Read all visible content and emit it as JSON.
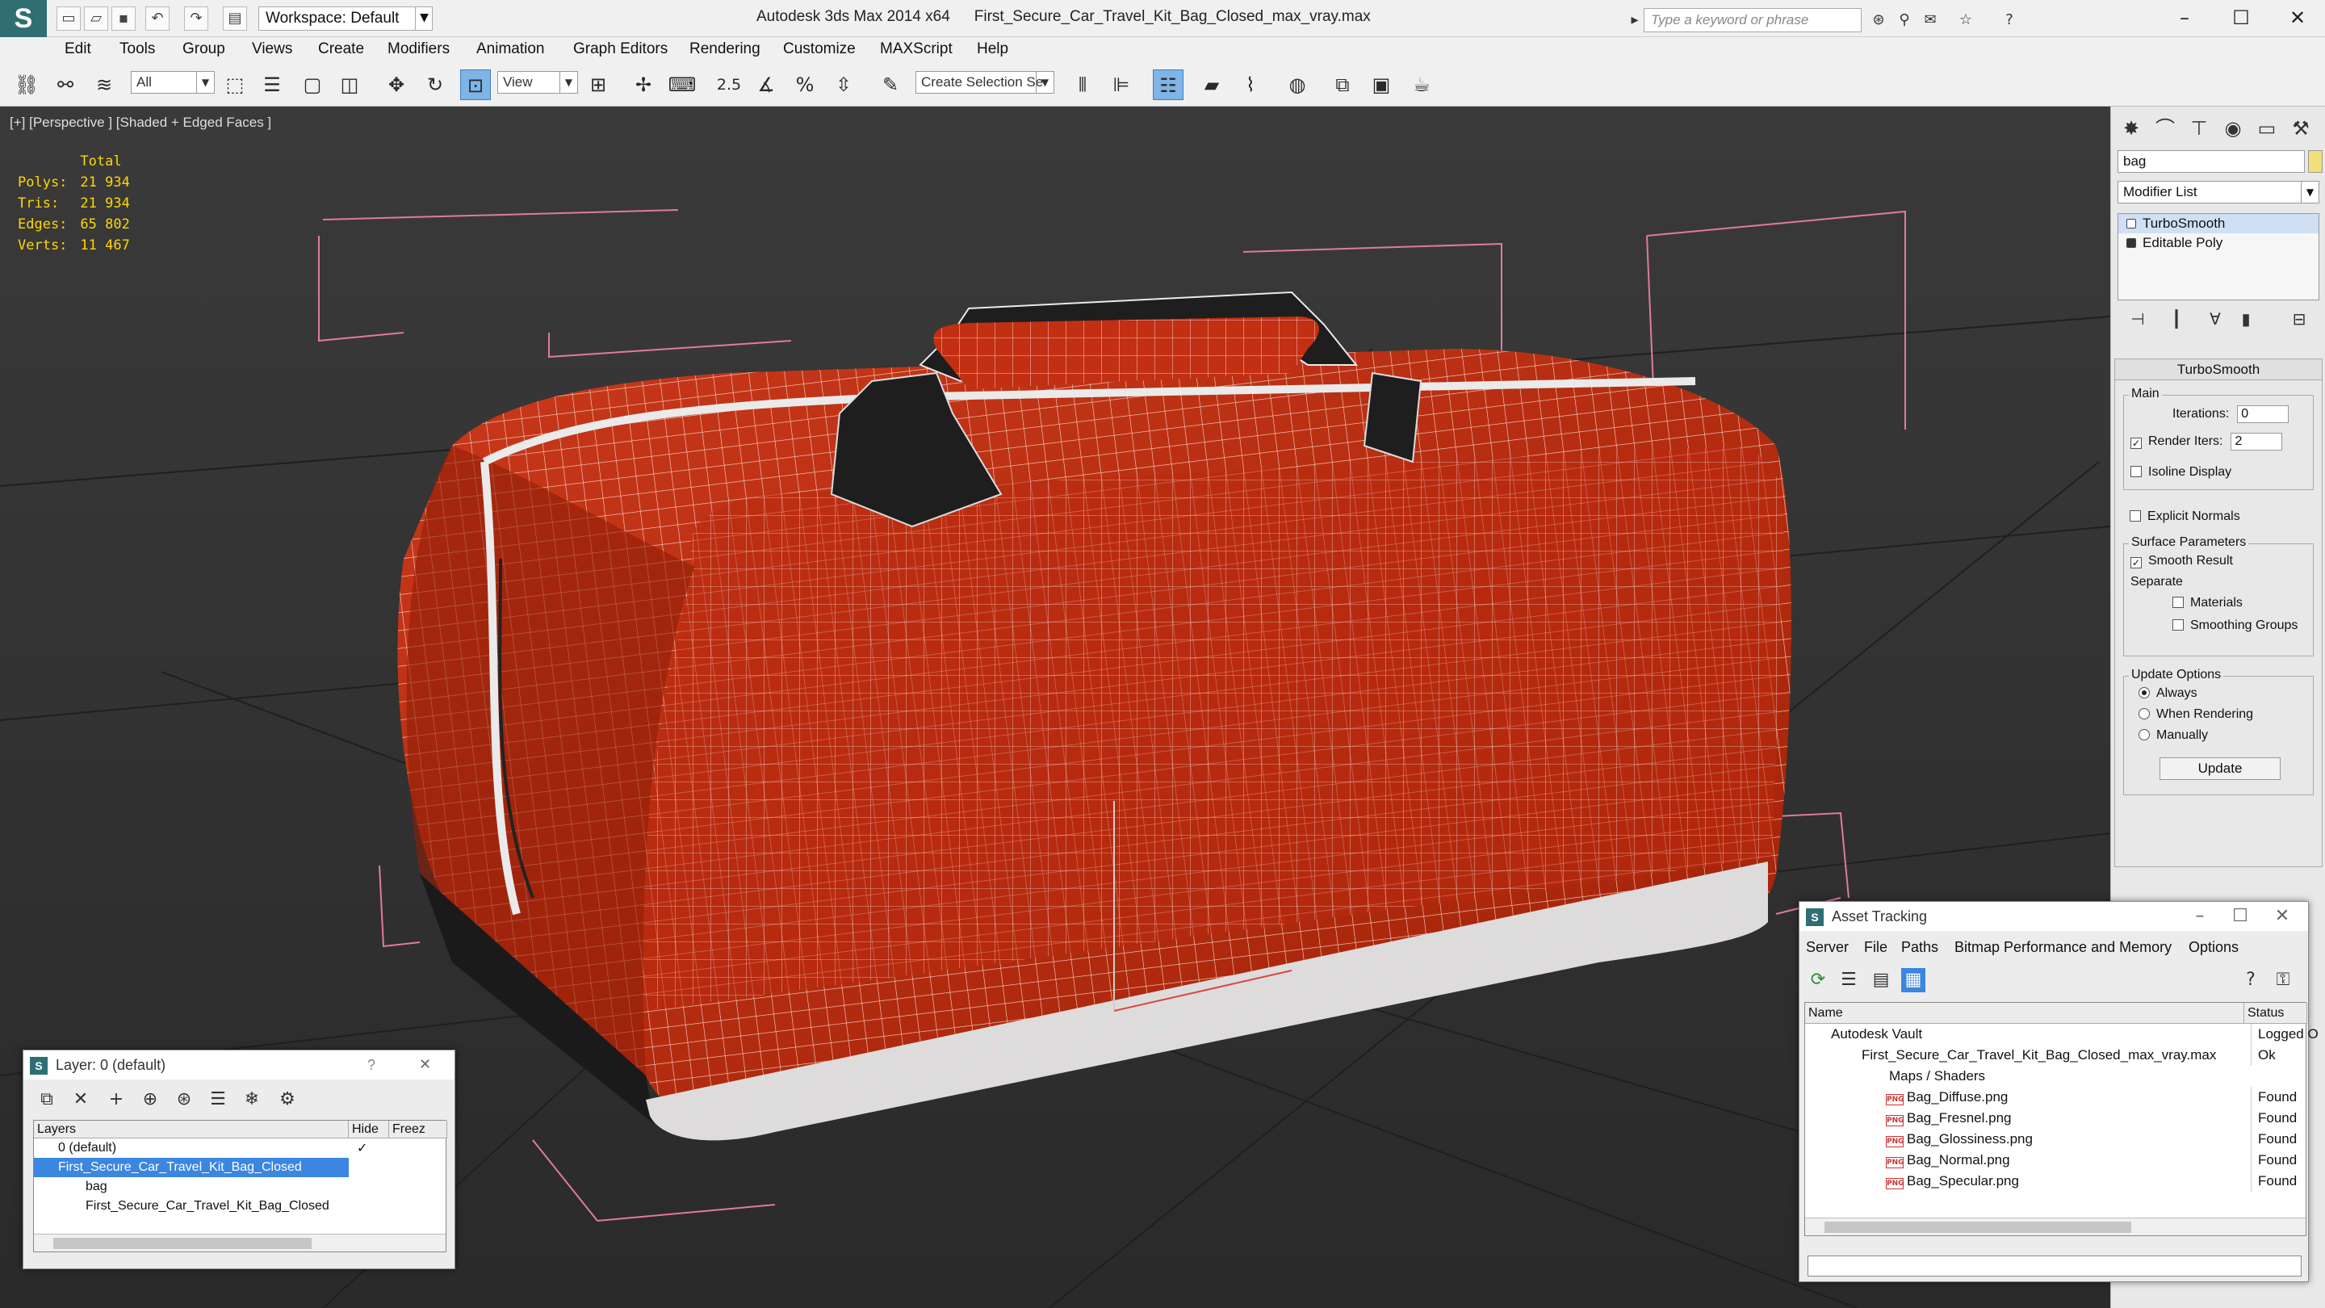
{
  "titlebar": {
    "workspace": "Workspace: Default",
    "app": "Autodesk 3ds Max  2014 x64",
    "file": "First_Secure_Car_Travel_Kit_Bag_Closed_max_vray.max",
    "search_placeholder": "Type a keyword or phrase"
  },
  "menubar": [
    "Edit",
    "Tools",
    "Group",
    "Views",
    "Create",
    "Modifiers",
    "Animation",
    "Graph Editors",
    "Rendering",
    "Customize",
    "MAXScript",
    "Help"
  ],
  "toolbar": {
    "filter": "All",
    "view": "View",
    "snap_angle": "2.5",
    "selection_set": "Create Selection Se"
  },
  "viewport": {
    "label": "[+] [Perspective ] [Shaded + Edged Faces ]",
    "stats_header": "Total",
    "stats": [
      {
        "label": "Polys:",
        "value": "21 934"
      },
      {
        "label": "Tris:",
        "value": "21 934"
      },
      {
        "label": "Edges:",
        "value": "65 802"
      },
      {
        "label": "Verts:",
        "value": "11 467"
      }
    ]
  },
  "command_panel": {
    "object_name": "bag",
    "modifier_list": "Modifier List",
    "stack": [
      "TurboSmooth",
      "Editable Poly"
    ],
    "turbosmooth": {
      "title": "TurboSmooth",
      "main_label": "Main",
      "iterations_label": "Iterations:",
      "iterations": "0",
      "render_iters_label": "Render Iters:",
      "render_iters": "2",
      "isoline": "Isoline Display",
      "explicit_normals": "Explicit Normals",
      "surface_params": "Surface Parameters",
      "smooth_result": "Smooth Result",
      "separate": "Separate",
      "materials": "Materials",
      "smoothing_groups": "Smoothing Groups",
      "update_options": "Update Options",
      "always": "Always",
      "when_rendering": "When Rendering",
      "manually": "Manually",
      "update_button": "Update"
    }
  },
  "layer_window": {
    "title": "Layer: 0 (default)",
    "help": "?",
    "columns": [
      "Layers",
      "Hide",
      "Freez"
    ],
    "rows": [
      "0 (default)",
      "First_Secure_Car_Travel_Kit_Bag_Closed",
      "bag",
      "First_Secure_Car_Travel_Kit_Bag_Closed"
    ]
  },
  "asset_window": {
    "title": "Asset Tracking",
    "menu": [
      "Server",
      "File",
      "Paths",
      "Bitmap Performance and Memory",
      "Options"
    ],
    "columns": [
      "Name",
      "Status"
    ],
    "rows": [
      {
        "name": "Autodesk Vault",
        "status": "Logged O"
      },
      {
        "name": "First_Secure_Car_Travel_Kit_Bag_Closed_max_vray.max",
        "status": "Ok"
      },
      {
        "name": "Maps / Shaders",
        "status": ""
      },
      {
        "name": "Bag_Diffuse.png",
        "status": "Found"
      },
      {
        "name": "Bag_Fresnel.png",
        "status": "Found"
      },
      {
        "name": "Bag_Glossiness.png",
        "status": "Found"
      },
      {
        "name": "Bag_Normal.png",
        "status": "Found"
      },
      {
        "name": "Bag_Specular.png",
        "status": "Found"
      }
    ]
  },
  "colors": {
    "bag_red": "#b52a10",
    "reflective_strip": "#d8d8d8",
    "selection_blue": "#3a86e0",
    "stats_yellow": "#ffd700"
  }
}
